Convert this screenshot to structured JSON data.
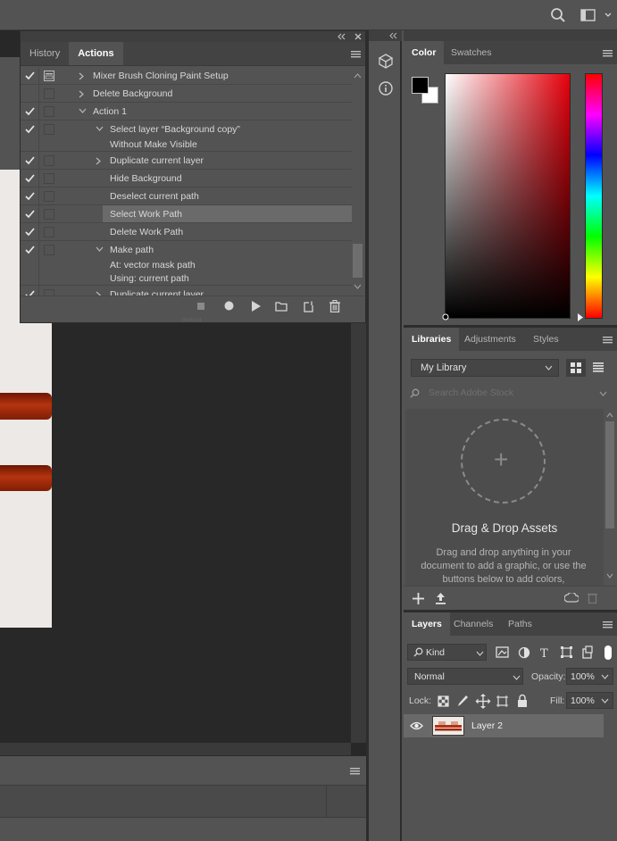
{
  "actions_panel": {
    "tabs": [
      "History",
      "Actions"
    ],
    "active_tab": "Actions",
    "items": [
      {
        "label": "Mixer Brush Cloning Paint Setup",
        "checked": true,
        "dialog": true,
        "level": 0,
        "chevron": "right"
      },
      {
        "label": "Delete Background",
        "checked": false,
        "dialog": false,
        "level": 0,
        "chevron": "right"
      },
      {
        "label": "Action 1",
        "checked": true,
        "dialog": false,
        "level": 0,
        "chevron": "down"
      },
      {
        "label": "Select layer “Background copy”",
        "sub": "Without Make Visible",
        "checked": true,
        "dialog": false,
        "level": 1,
        "chevron": "down"
      },
      {
        "label": "Duplicate current layer",
        "checked": true,
        "dialog": false,
        "level": 1,
        "chevron": "right"
      },
      {
        "label": "Hide Background",
        "checked": true,
        "dialog": false,
        "level": 1,
        "chevron": ""
      },
      {
        "label": "Deselect current path",
        "checked": true,
        "dialog": false,
        "level": 1,
        "chevron": ""
      },
      {
        "label": "Select Work Path",
        "checked": true,
        "dialog": false,
        "level": 1,
        "chevron": "",
        "selected": true
      },
      {
        "label": "Delete Work Path",
        "checked": true,
        "dialog": false,
        "level": 1,
        "chevron": ""
      },
      {
        "label": "Make path",
        "sub": "At: vector mask path",
        "sub2": "Using: current path",
        "checked": true,
        "dialog": false,
        "level": 1,
        "chevron": "down"
      },
      {
        "label": "Duplicate current layer",
        "checked": true,
        "dialog": false,
        "level": 1,
        "chevron": "right"
      }
    ],
    "footer_icons": [
      "stop-icon",
      "record-icon",
      "play-icon",
      "folder-icon",
      "new-action-icon",
      "trash-icon"
    ]
  },
  "color_panel": {
    "tabs": [
      "Color",
      "Swatches"
    ],
    "active_tab": "Color",
    "foreground": "#000000",
    "background": "#ffffff",
    "hue_color": "#e6000c"
  },
  "libraries_panel": {
    "tabs": [
      "Libraries",
      "Adjustments",
      "Styles"
    ],
    "active_tab": "Libraries",
    "library_select": "My Library",
    "search_placeholder": "Search Adobe Stock",
    "drop_title": "Drag & Drop Assets",
    "drop_text": "Drag and drop anything in your document to add a graphic, or use the buttons below to add colors,"
  },
  "layers_panel": {
    "tabs": [
      "Layers",
      "Channels",
      "Paths"
    ],
    "active_tab": "Layers",
    "filter_kind": "Kind",
    "blend_mode": "Normal",
    "opacity_label": "Opacity:",
    "opacity_value": "100%",
    "lock_label": "Lock:",
    "fill_label": "Fill:",
    "fill_value": "100%",
    "layers": [
      {
        "name": "Layer 2",
        "visible": true
      }
    ]
  }
}
